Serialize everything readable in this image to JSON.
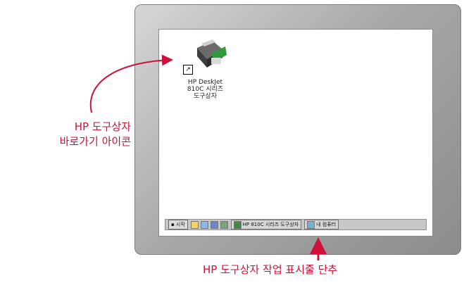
{
  "desktop_icon": {
    "name": "HP DeskJet printer shortcut icon",
    "label_lines": [
      "HP DeskJet",
      "810C 시리즈",
      "도구상자"
    ]
  },
  "taskbar": {
    "start_label": "시작",
    "quick_launch_icons": [
      "ie-icon",
      "email-icon",
      "desktop-icon",
      "channels-icon"
    ],
    "tasks": [
      {
        "label": "HP 810C 시리즈 도구상자",
        "icon": "printer-icon"
      },
      {
        "label": "내 컴퓨터",
        "icon": "computer-icon"
      }
    ]
  },
  "callouts": {
    "shortcut_lines": [
      "HP 도구상자",
      "바로가기 아이콘"
    ],
    "taskbar_button": "HP 도구상자 작업 표시줄 단추"
  },
  "colors": {
    "callout": "#d0103a",
    "bezel": "#a9a9a9",
    "screen": "#ffffff",
    "taskbar": "#c7c7c7"
  }
}
